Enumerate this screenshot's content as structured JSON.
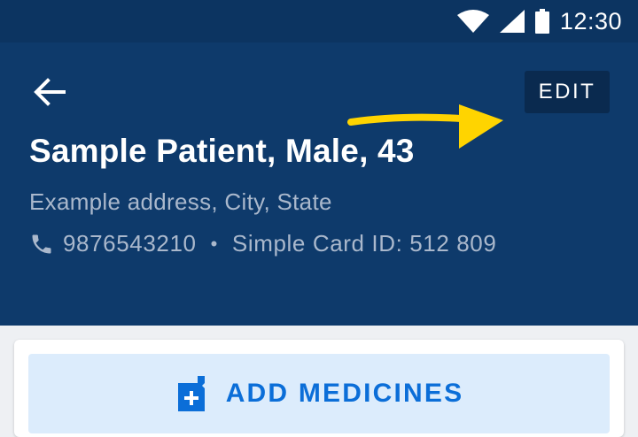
{
  "status_bar": {
    "time": "12:30",
    "icons": [
      "wifi-icon",
      "signal-icon",
      "battery-icon"
    ]
  },
  "header": {
    "back_icon": "arrow-left-icon",
    "edit_label": "EDIT",
    "patient_name": "Sample Patient, Male, 43",
    "address": "Example address, City, State",
    "phone_icon": "phone-icon",
    "phone": "9876543210",
    "separator": "•",
    "card_id": "Simple Card ID: 512 809"
  },
  "annotation": {
    "icon": "arrow-right-icon",
    "color": "#ffd400"
  },
  "medicines": {
    "icon": "medicine-add-icon",
    "button_label": "ADD MEDICINES"
  },
  "colors": {
    "status_bar": "#0c3461",
    "header": "#0e3a6b",
    "edit_button": "#0a2a4f",
    "accent": "#0b6ed8",
    "button_bg": "#dcecfc"
  }
}
